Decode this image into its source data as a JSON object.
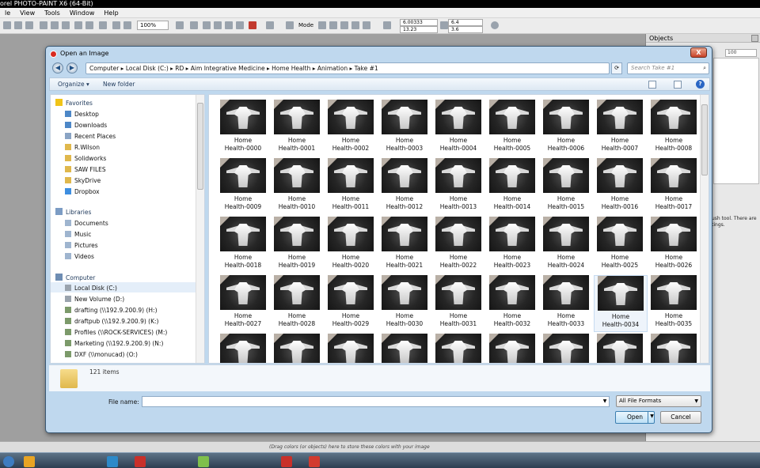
{
  "app": {
    "title": "orel PHOTO-PAINT X6 (64-Bit)",
    "menu": [
      "le",
      "View",
      "Tools",
      "Window",
      "Help"
    ],
    "toolbar": {
      "zoom": "100%",
      "mode_label": "Mode",
      "x_value": "6.00333",
      "y_value": "13.23",
      "w_value": "6.4",
      "h_value": "3.6"
    },
    "docker": {
      "title": "Objects",
      "opacity": "100",
      "hint": "ush tool.  There are tings."
    },
    "status_hint": "(Drag colors (or objects) here to store these colors with your image"
  },
  "dialog": {
    "title": "Open an Image",
    "close_label": "X",
    "breadcrumb": "Computer  ▸  Local Disk (C:)  ▸  RD  ▸  Aim Integrative Medicine  ▸  Home Health  ▸  Animation  ▸  Take #1",
    "search_placeholder": "Search Take #1",
    "organize_label": "Organize ▾",
    "new_folder_label": "New folder",
    "favorites": {
      "header": "Favorites",
      "items": [
        "Desktop",
        "Downloads",
        "Recent Places",
        "R.Wilson",
        "Solidworks",
        "SAW FILES",
        "SkyDrive",
        "Dropbox"
      ]
    },
    "libraries": {
      "header": "Libraries",
      "items": [
        "Documents",
        "Music",
        "Pictures",
        "Videos"
      ]
    },
    "computer": {
      "header": "Computer",
      "items": [
        "Local Disk (C:)",
        "New Volume (D:)",
        "drafting (\\\\192.9.200.9) (H:)",
        "draftpub (\\\\192.9.200.9) (K:)",
        "Profiles (\\\\ROCK-SERVICES) (M:)",
        "Marketing (\\\\192.9.200.9) (N:)",
        "DXF (\\\\monucad) (O:)"
      ]
    },
    "files": [
      "Health-0000",
      "Health-0001",
      "Health-0002",
      "Health-0003",
      "Health-0004",
      "Health-0005",
      "Health-0006",
      "Health-0007",
      "Health-0008",
      "Health-0009",
      "Health-0010",
      "Health-0011",
      "Health-0012",
      "Health-0013",
      "Health-0014",
      "Health-0015",
      "Health-0016",
      "Health-0017",
      "Health-0018",
      "Health-0019",
      "Health-0020",
      "Health-0021",
      "Health-0022",
      "Health-0023",
      "Health-0024",
      "Health-0025",
      "Health-0026",
      "Health-0027",
      "Health-0028",
      "Health-0029",
      "Health-0030",
      "Health-0031",
      "Health-0032",
      "Health-0033",
      "Health-0034",
      "Health-0035"
    ],
    "file_prefix": "Home",
    "selected_file": "Health-0034",
    "item_count": "121 items",
    "filename_label": "File name:",
    "filename_value": "",
    "file_type": "All File Formats",
    "open_label": "Open",
    "cancel_label": "Cancel"
  }
}
